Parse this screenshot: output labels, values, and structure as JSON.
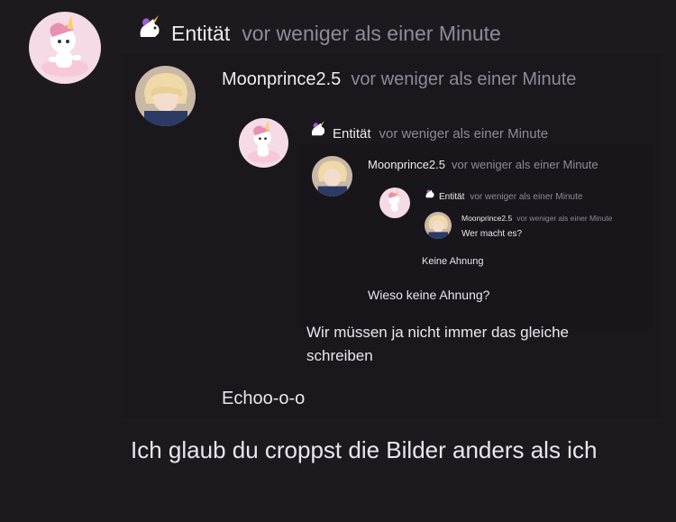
{
  "messages": [
    {
      "author": "Entität",
      "time": "vor weniger als einer Minute",
      "icon": "unicorn-icon",
      "text": "Ich glaub du croppst die Bilder anders als ich"
    },
    {
      "author": "Moonprince2.5",
      "time": "vor weniger als einer Minute",
      "text": "Echoo-o-o"
    },
    {
      "author": "Entität",
      "time": "vor weniger als einer Minute",
      "icon": "unicorn-icon",
      "text": "Wir müssen ja nicht immer das gleiche schreiben"
    },
    {
      "author": "Moonprince2.5",
      "time": "vor weniger als einer Minute",
      "text": "Wieso keine Ahnung?"
    },
    {
      "author": "Entität",
      "time": "vor weniger als einer Minute",
      "icon": "unicorn-icon",
      "text": "Keine Ahnung"
    },
    {
      "author": "Moonprince2.5",
      "time": "vor weniger als einer Minute",
      "text": "Wer macht es?"
    }
  ],
  "colors": {
    "background": "#1c1a1f",
    "name": "#ecebef",
    "time": "#8f8b96"
  }
}
